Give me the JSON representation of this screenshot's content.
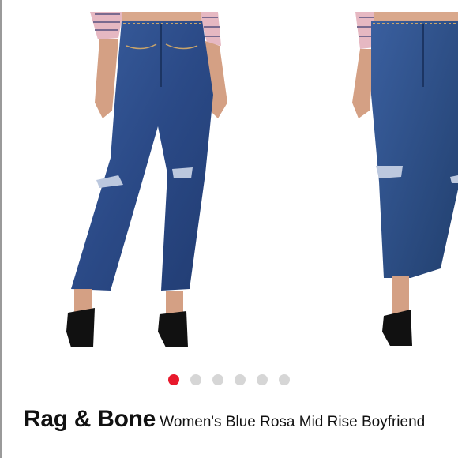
{
  "product": {
    "brand": "Rag & Bone",
    "title": "Women's Blue Rosa Mid Rise Boyfriend"
  },
  "carousel": {
    "slide_count": 6,
    "active_index": 0,
    "images": [
      {
        "icon": "jeans-model-photo-front"
      },
      {
        "icon": "jeans-model-photo-angle"
      }
    ]
  },
  "colors": {
    "accent": "#e8192c",
    "denim": "#2e4f8f",
    "dot_inactive": "#d6d6d6"
  }
}
